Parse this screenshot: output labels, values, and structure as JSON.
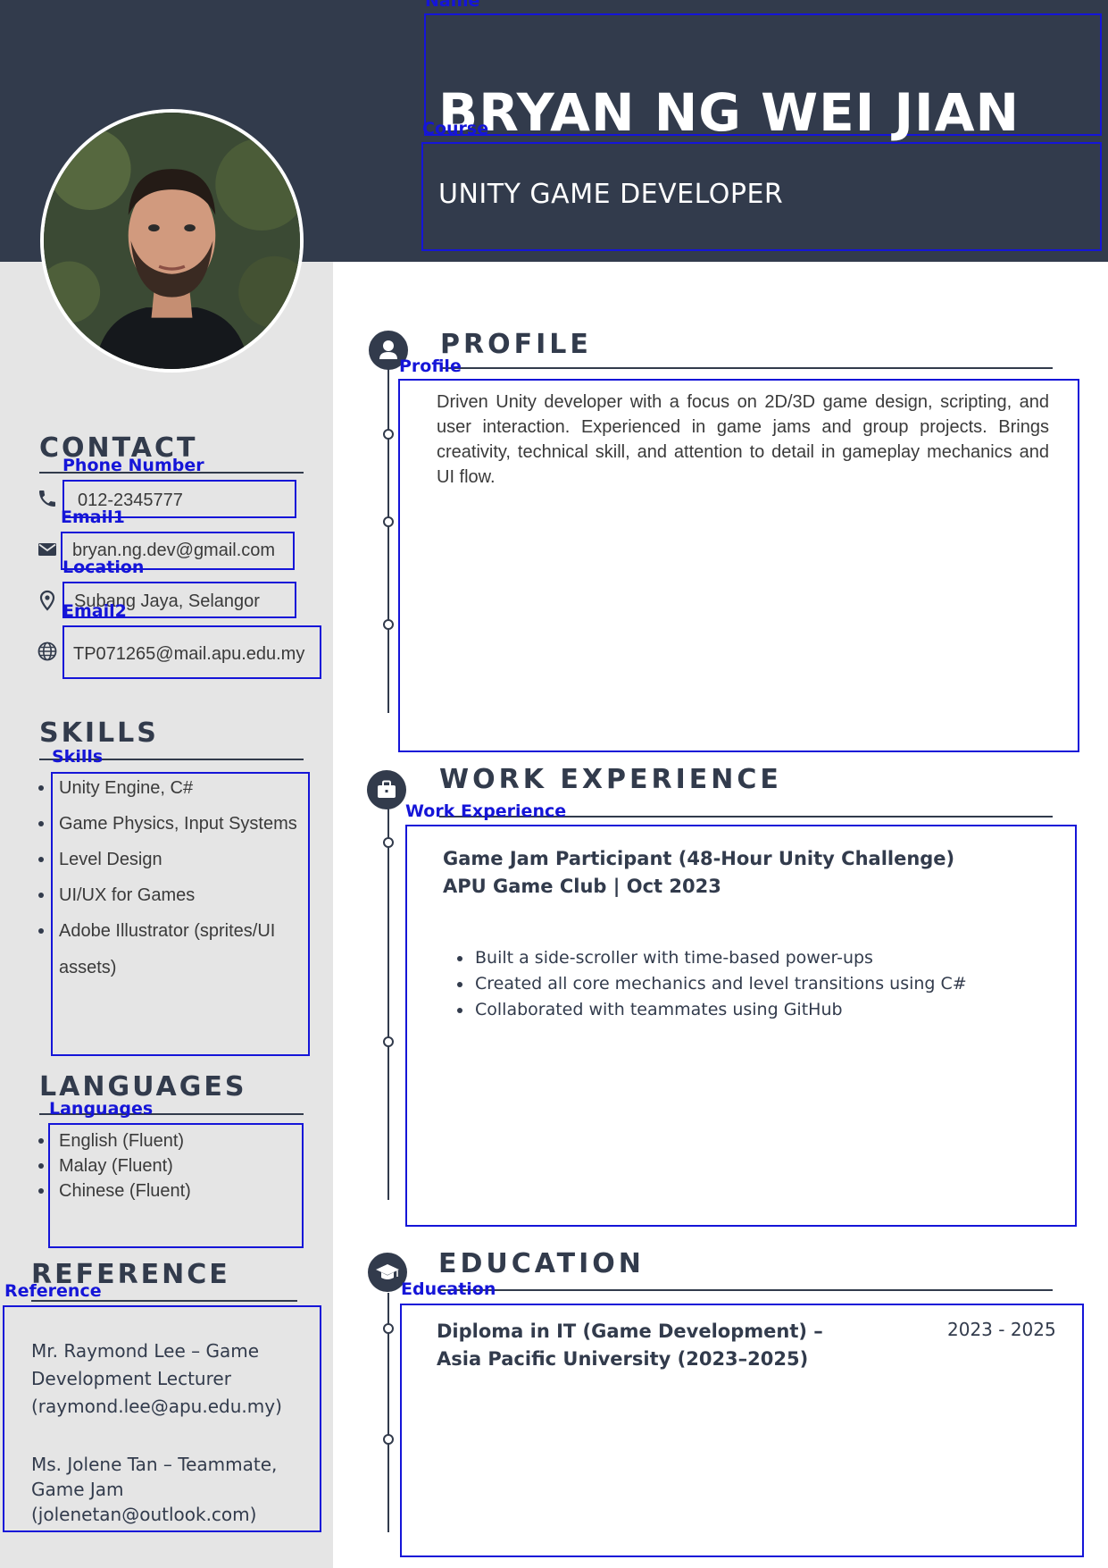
{
  "header": {
    "name": "BRYAN NG WEI JIAN",
    "course": "UNITY GAME DEVELOPER",
    "name_label": "Name",
    "course_label": "Course"
  },
  "contact": {
    "heading": "CONTACT",
    "phone_label": "Phone Number",
    "phone": "012-2345777",
    "email1_label": "Email1",
    "email1": "bryan.ng.dev@gmail.com",
    "location_label": "Location",
    "location": "Subang Jaya, Selangor",
    "email2_label": "Email2",
    "email2": "TP071265@mail.apu.edu.my"
  },
  "skills": {
    "heading": "SKILLS",
    "label": "Skills",
    "items": [
      "Unity Engine, C#",
      "Game Physics, Input Systems",
      "Level Design",
      "UI/UX for Games",
      "Adobe Illustrator (sprites/UI assets)"
    ]
  },
  "languages": {
    "heading": "LANGUAGES",
    "label": "Languages",
    "items": [
      "English (Fluent)",
      "Malay (Fluent)",
      "Chinese (Fluent)"
    ]
  },
  "reference": {
    "heading": "REFERENCE",
    "label": "Reference",
    "ref1": "Mr. Raymond Lee – Game Development Lecturer (raymond.lee@apu.edu.my)",
    "ref2": "Ms. Jolene Tan – Teammate, Game Jam (jolenetan@outlook.com)"
  },
  "profile": {
    "heading": "PROFILE",
    "label": "Profile",
    "text": "Driven Unity developer with a focus on 2D/3D game design, scripting, and user interaction. Experienced in game jams and group projects. Brings creativity, technical skill, and attention to detail in gameplay mechanics and UI flow."
  },
  "work": {
    "heading": "WORK EXPERIENCE",
    "label": "Work Experience",
    "title_line1": "Game Jam Participant (48-Hour Unity Challenge)",
    "title_line2": "APU Game Club | Oct 2023",
    "bullets": [
      "Built a side-scroller with time-based power-ups",
      "Created all core mechanics and level transitions using C#",
      "Collaborated with teammates using GitHub"
    ]
  },
  "education": {
    "heading": "EDUCATION",
    "label": "Education",
    "title": "Diploma in IT (Game Development) – Asia Pacific University (2023–2025)",
    "dates": "2023 - 2025"
  },
  "colors": {
    "navy": "#323b4c",
    "sidebar": "#e5e5e5",
    "field_box": "#1515d8"
  },
  "icons": {
    "phone": "phone-icon",
    "email": "envelope-icon",
    "location": "map-pin-icon",
    "web": "globe-icon",
    "profile": "user-icon",
    "work": "briefcase-icon",
    "education": "graduation-cap-icon"
  }
}
